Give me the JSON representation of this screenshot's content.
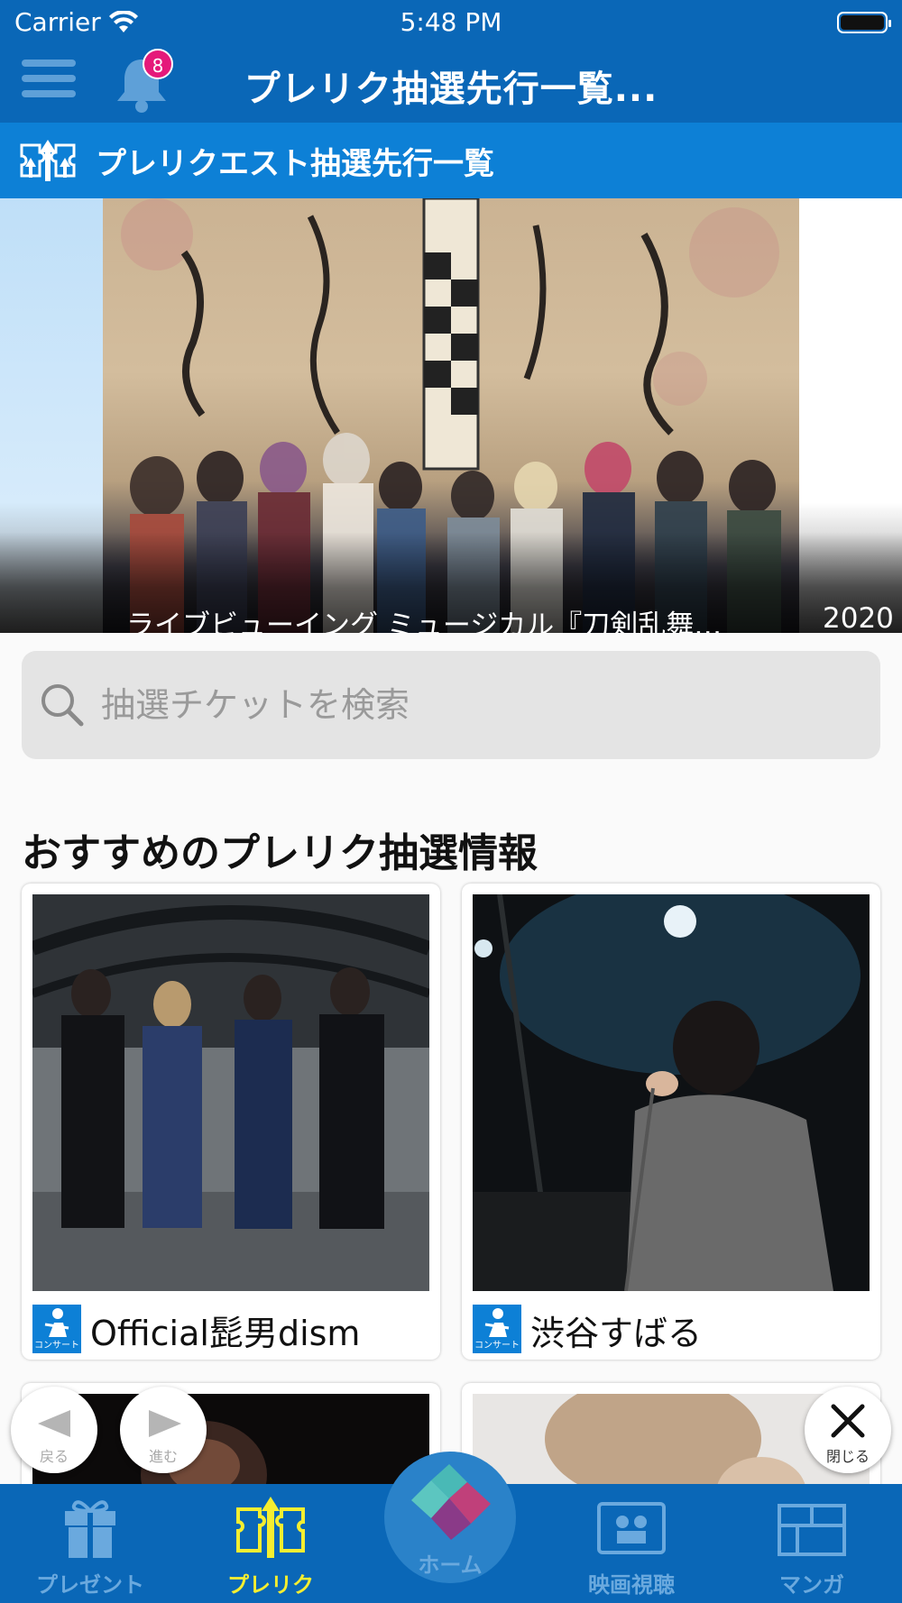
{
  "status_bar": {
    "carrier": "Carrier",
    "time": "5:48 PM"
  },
  "nav": {
    "title": "プレリク抽選先行一覧...",
    "notification_count": "8"
  },
  "subheader": {
    "title": "プレリクエスト抽選先行一覧"
  },
  "banner": {
    "caption": "ライブビューイング ミュージカル『刀剣乱舞…",
    "next_caption": "2020"
  },
  "search": {
    "placeholder": "抽選チケットを検索"
  },
  "section": {
    "title": "おすすめのプレリク抽選情報"
  },
  "cards": [
    {
      "category": "コンサート",
      "name": "Official髭男dism"
    },
    {
      "category": "コンサート",
      "name": "渋谷すばる"
    }
  ],
  "controls": {
    "back": "戻る",
    "forward": "進む",
    "close": "閉じる"
  },
  "tabs": [
    {
      "label": "プレゼント"
    },
    {
      "label": "プレリク"
    },
    {
      "label": "ホーム"
    },
    {
      "label": "映画視聴"
    },
    {
      "label": "マンガ"
    }
  ],
  "colors": {
    "brand": "#0a67b7",
    "subheader": "#0d80d6",
    "active_tab": "#f5ee30",
    "badge": "#e5197a"
  }
}
